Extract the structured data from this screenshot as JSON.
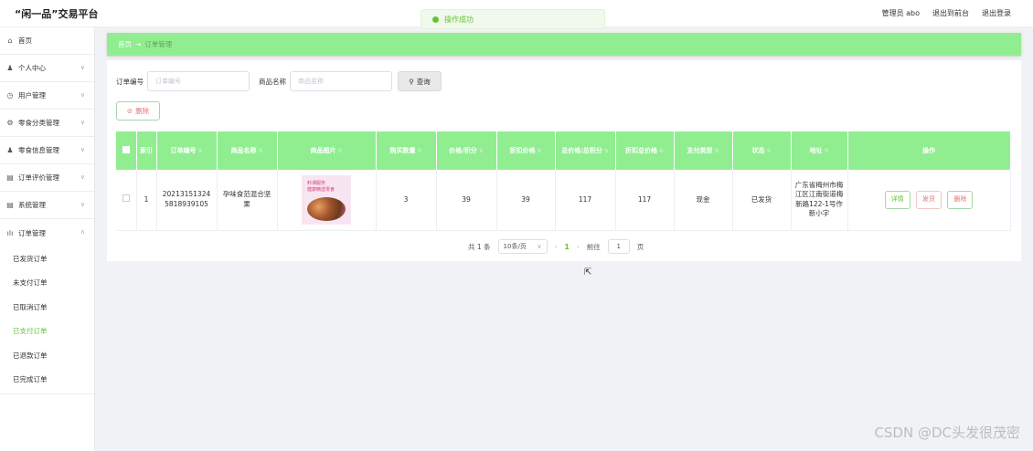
{
  "app": {
    "title": "“闲一品”交易平台"
  },
  "header": {
    "admin_label": "管理员 abo",
    "front_label": "退出到前台",
    "logout_label": "退出登录"
  },
  "toast": {
    "message": "操作成功"
  },
  "sidebar": {
    "items": [
      {
        "label": "首页",
        "icon": "home-icon"
      },
      {
        "label": "个人中心",
        "icon": "person-icon"
      },
      {
        "label": "用户管理",
        "icon": "clock-icon"
      },
      {
        "label": "零食分类管理",
        "icon": "gear-icon"
      },
      {
        "label": "零食信息管理",
        "icon": "person-icon"
      },
      {
        "label": "订单评价管理",
        "icon": "doc-icon"
      },
      {
        "label": "系统管理",
        "icon": "doc-icon"
      },
      {
        "label": "订单管理",
        "icon": "bar-chart-icon"
      }
    ],
    "subitems": [
      {
        "label": "已发货订单"
      },
      {
        "label": "未支付订单"
      },
      {
        "label": "已取消订单"
      },
      {
        "label": "已支付订单",
        "active": true
      },
      {
        "label": "已退款订单"
      },
      {
        "label": "已完成订单"
      }
    ]
  },
  "breadcrumb": {
    "home": "首页",
    "sep": "→",
    "current": "订单管理"
  },
  "search": {
    "order_no_label": "订单编号",
    "order_no_placeholder": "订单编号",
    "product_label": "商品名称",
    "product_placeholder": "商品名称",
    "search_button": "查询",
    "delete_button": "删除"
  },
  "table": {
    "headers": [
      "索引",
      "订单编号",
      "商品名称",
      "商品图片",
      "购买数量",
      "价格/积分",
      "折扣价格",
      "总价格/总积分",
      "折扣总价格",
      "支付类型",
      "状态",
      "地址",
      "操作"
    ],
    "rows": [
      {
        "index": "1",
        "order_no": "202131513245818939105",
        "product": "孕味食范混合坚果",
        "image_title": "料课服务",
        "image_sub": "健康精选零食",
        "qty": "3",
        "price": "39",
        "discount_price": "39",
        "total": "117",
        "discount_total": "117",
        "pay_type": "现金",
        "status": "已发货",
        "address": "广东省梅州市梅江区江南街道梅新路122-1号作新小字"
      }
    ],
    "actions": {
      "detail": "详情",
      "ship": "发货",
      "remove": "删除"
    }
  },
  "pagination": {
    "total": "共 1 条",
    "page_size": "10条/页",
    "current_page": "1",
    "goto_label": "前往",
    "goto_value": "1",
    "page_suffix": "页"
  },
  "watermark": "CSDN @DC头发很茂密"
}
